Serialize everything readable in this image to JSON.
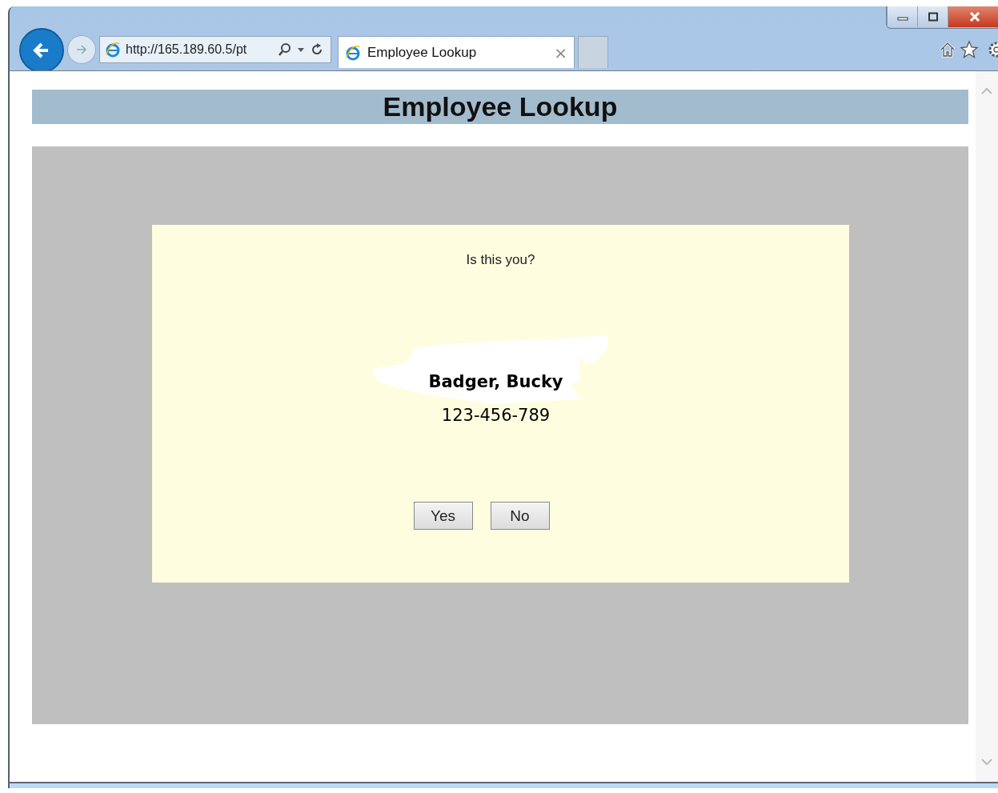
{
  "browser": {
    "address": "http://165.189.60.5/pt",
    "tabs": [
      {
        "title": "Employee Lookup",
        "close": "×",
        "selected": true
      }
    ]
  },
  "page": {
    "heading": "Employee Lookup",
    "prompt": "Is this you?",
    "name": "Badger, Bucky",
    "id_number": "123-456-789",
    "buttons": [
      "Yes",
      "No"
    ]
  }
}
